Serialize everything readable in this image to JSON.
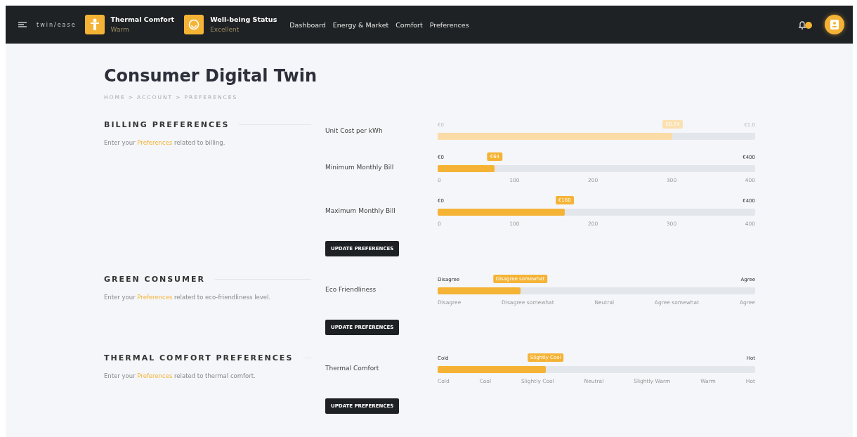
{
  "header": {
    "logo": "twin/ease",
    "status_items": [
      {
        "kind": "person",
        "title": "Thermal Comfort",
        "value": "Warm"
      },
      {
        "kind": "smile",
        "title": "Well-being Status",
        "value": "Excellent"
      }
    ],
    "nav": [
      {
        "label": "Dashboard"
      },
      {
        "label": "Energy & Market"
      },
      {
        "label": "Comfort"
      },
      {
        "label": "Preferences"
      }
    ]
  },
  "page": {
    "title": "Consumer Digital Twin",
    "breadcrumb": [
      "HOME",
      "ACCOUNT",
      "PREFERENCES"
    ],
    "breadcrumb_separator": ">"
  },
  "sections": [
    {
      "heading": "BILLING PREFERENCES",
      "description": "Enter your **Preferences** related to billing.",
      "button": "UPDATE PREFERENCES",
      "sliders": [
        {
          "label": "Unit Cost per kWh",
          "disabled": true,
          "min_label": "€0",
          "max_label": "€1.0",
          "value": "€0.74",
          "level": 0.74
        },
        {
          "label": "Minimum Monthly Bill",
          "disabled": false,
          "min_label": "€0",
          "max_label": "€400",
          "value": "€64",
          "level": 0.18,
          "ticks": [
            "0",
            "100",
            "200",
            "300",
            "400"
          ]
        },
        {
          "label": "Maximum Monthly Bill",
          "disabled": false,
          "min_label": "€0",
          "max_label": "€400",
          "value": "€160",
          "level": 0.4,
          "ticks": [
            "0",
            "100",
            "200",
            "300",
            "400"
          ]
        }
      ]
    },
    {
      "heading": "GREEN CONSUMER",
      "description": "Enter your **Preferences** related to eco-friendliness level.",
      "button": "UPDATE PREFERENCES",
      "sliders": [
        {
          "label": "Eco Friendliness",
          "disabled": false,
          "min_label": "Disagree",
          "max_label": "Agree",
          "value": "Disagree somewhat",
          "level": 0.26,
          "ticks": [
            "Disagree",
            "Disagree somewhat",
            "Neutral",
            "Agree somewhat",
            "Agree"
          ]
        }
      ]
    },
    {
      "heading": "THERMAL COMFORT PREFERENCES",
      "description": "Enter your **Preferences** related to thermal comfort.",
      "button": "UPDATE PREFERENCES",
      "sliders": [
        {
          "label": "Thermal Comfort",
          "disabled": false,
          "min_label": "Cold",
          "max_label": "Hot",
          "value": "Slightly Cool",
          "level": 0.34,
          "ticks": [
            "Cold",
            "Cool",
            "Slightly Cool",
            "Neutral",
            "Slightly Warm",
            "Warm",
            "Hot"
          ]
        }
      ]
    }
  ]
}
